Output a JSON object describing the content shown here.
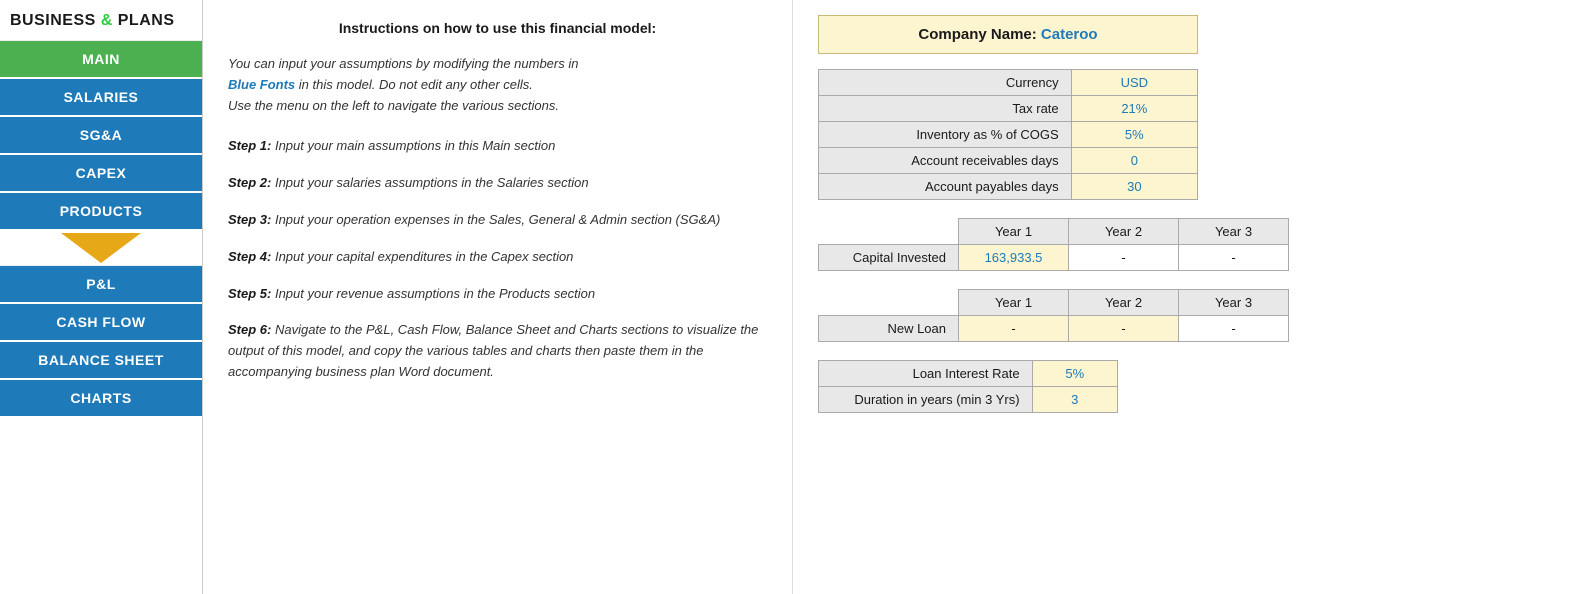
{
  "logo": {
    "text_before": "BUSINESS ",
    "ampersand": "&",
    "text_after": " PLANS"
  },
  "sidebar": {
    "items": [
      {
        "id": "main",
        "label": "MAIN",
        "active": true
      },
      {
        "id": "salaries",
        "label": "SALARIES",
        "active": false
      },
      {
        "id": "sga",
        "label": "SG&A",
        "active": false
      },
      {
        "id": "capex",
        "label": "CAPEX",
        "active": false
      },
      {
        "id": "products",
        "label": "PRODUCTS",
        "active": false
      },
      {
        "id": "pl",
        "label": "P&L",
        "active": false
      },
      {
        "id": "cashflow",
        "label": "CASH FLOW",
        "active": false
      },
      {
        "id": "balance",
        "label": "BALANCE SHEET",
        "active": false
      },
      {
        "id": "charts",
        "label": "CHARTS",
        "active": false
      }
    ]
  },
  "instructions": {
    "title": "Instructions on how to use this financial model:",
    "intro_line1": "You can input your assumptions by modifying the numbers in",
    "intro_blue": "Blue Fonts",
    "intro_line2": " in this model. Do not edit any other cells.",
    "intro_line3": "Use the menu on the left to navigate the various sections.",
    "steps": [
      {
        "label": "Step 1:",
        "text": " Input your main assumptions in this Main section"
      },
      {
        "label": "Step 2:",
        "text": " Input your salaries assumptions in the Salaries section"
      },
      {
        "label": "Step 3:",
        "text": " Input your operation expenses in the Sales, General & Admin section (SG&A)"
      },
      {
        "label": "Step 4:",
        "text": " Input your capital expenditures in the Capex section"
      },
      {
        "label": "Step 5:",
        "text": " Input your revenue assumptions in the Products section"
      },
      {
        "label": "Step 6:",
        "text": " Navigate to the P&L, Cash Flow, Balance Sheet and Charts sections to visualize the output of this model, and copy the various tables and charts then paste them in the accompanying business plan Word document."
      }
    ]
  },
  "company": {
    "label": "Company Name:",
    "value": "Cateroo"
  },
  "settings": {
    "rows": [
      {
        "label": "Currency",
        "value": "USD"
      },
      {
        "label": "Tax rate",
        "value": "21%"
      },
      {
        "label": "Inventory as % of COGS",
        "value": "5%"
      },
      {
        "label": "Account receivables days",
        "value": "0"
      },
      {
        "label": "Account payables days",
        "value": "30"
      }
    ]
  },
  "capital_invested": {
    "row_label": "Capital Invested",
    "year1_label": "Year 1",
    "year2_label": "Year 2",
    "year3_label": "Year 3",
    "year1_value": "163,933.5",
    "year2_value": "-",
    "year3_value": "-"
  },
  "new_loan": {
    "row_label": "New Loan",
    "year1_label": "Year 1",
    "year2_label": "Year 2",
    "year3_label": "Year 3",
    "year1_value": "-",
    "year2_value": "-",
    "year3_value": "-"
  },
  "loan_settings": {
    "rows": [
      {
        "label": "Loan Interest Rate",
        "value": "5%"
      },
      {
        "label": "Duration in years (min 3 Yrs)",
        "value": "3"
      }
    ]
  }
}
